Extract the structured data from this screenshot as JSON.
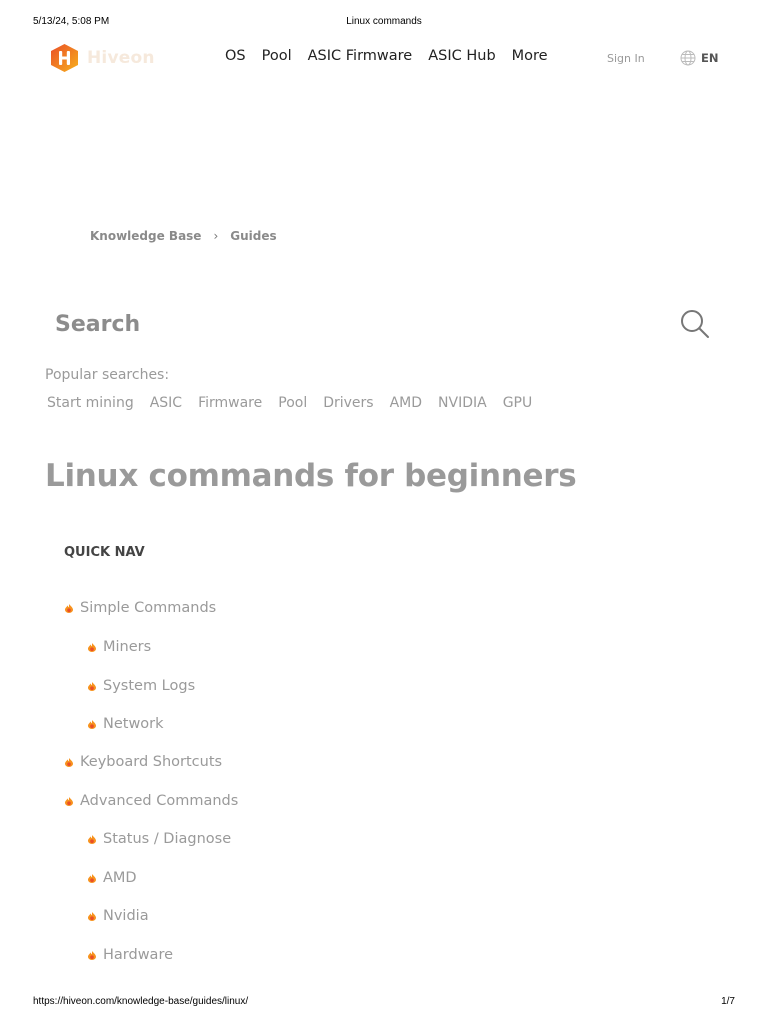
{
  "print": {
    "datetime": "5/13/24, 5:08 PM",
    "title": "Linux commands",
    "url": "https://hiveon.com/knowledge-base/guides/linux/",
    "page": "1/7"
  },
  "header": {
    "logo_text": "Hiveon",
    "nav": [
      "OS",
      "Pool",
      "ASIC Firmware",
      "ASIC Hub",
      "More"
    ],
    "sign_in": "Sign In",
    "language": "EN"
  },
  "breadcrumb": {
    "items": [
      "Knowledge Base",
      "Guides"
    ],
    "separator": "›"
  },
  "search": {
    "placeholder": "Search"
  },
  "popular": {
    "label": "Popular searches:",
    "tags": [
      "Start mining",
      "ASIC",
      "Firmware",
      "Pool",
      "Drivers",
      "AMD",
      "NVIDIA",
      "GPU"
    ]
  },
  "page_title": "Linux commands for beginners",
  "quick_nav": {
    "title": "QUICK NAV",
    "items": [
      {
        "label": "Simple Commands",
        "level": 1
      },
      {
        "label": "Miners",
        "level": 2
      },
      {
        "label": "System Logs",
        "level": 2
      },
      {
        "label": "Network",
        "level": 2
      },
      {
        "label": "Keyboard Shortcuts",
        "level": 1
      },
      {
        "label": "Advanced Commands",
        "level": 1
      },
      {
        "label": "Status / Diagnose",
        "level": 2
      },
      {
        "label": "AMD",
        "level": 2
      },
      {
        "label": "Nvidia",
        "level": 2
      },
      {
        "label": "Hardware",
        "level": 2
      }
    ]
  },
  "icons": {
    "logo": "hiveon-logo-icon",
    "globe": "globe-icon",
    "search": "search-icon",
    "bullet": "flame-bullet-icon"
  },
  "colors": {
    "brand_orange": "#f7931e",
    "brand_red": "#ea4e27",
    "muted_text": "#9a9a9a"
  }
}
